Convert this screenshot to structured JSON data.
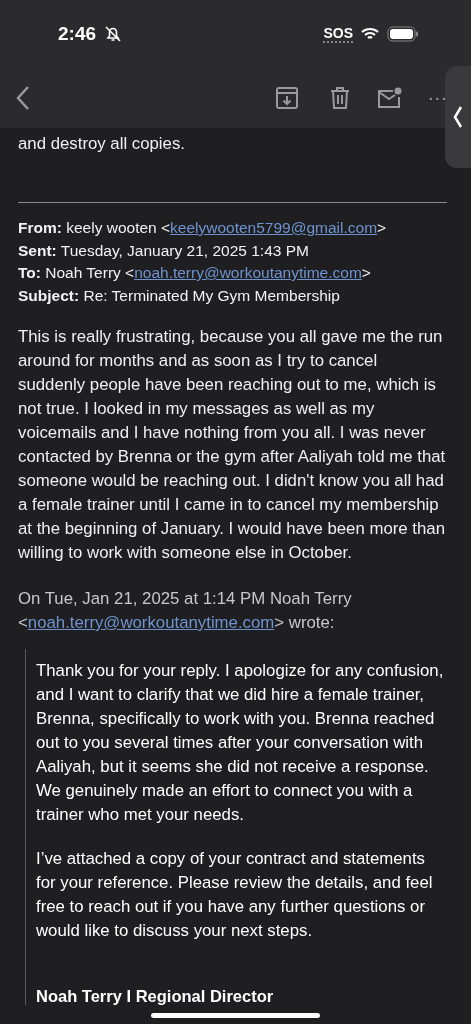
{
  "status_bar": {
    "time": "2:46",
    "sos": "SOS"
  },
  "toolbar": {
    "more": "..."
  },
  "body": {
    "trailing_text": "and destroy all copies.",
    "header_fields": [
      {
        "label": "From:",
        "text": "keely wooten <",
        "link": "keelywooten5799@gmail.com",
        "after": ">"
      },
      {
        "label": "Sent:",
        "text": "Tuesday, January 21, 2025 1:43 PM"
      },
      {
        "label": "To:",
        "text": "Noah Terry <",
        "link": "noah.terry@workoutanytime.com",
        "after": ">"
      },
      {
        "label": "Subject:",
        "text": "Re: Terminated My Gym Membership"
      }
    ],
    "paragraphs": [
      "This is really frustrating, because you all gave me the run around for months and as soon as I try to cancel suddenly people have been reaching out to me, which is not true. I looked in my messages as well as my voicemails and I have nothing from you all.  I was never contacted by Brenna or the gym after Aaliyah told me that someone would be reaching out. I didn't know you all had a female trainer until I came in to cancel my membership at the beginning of January. I would have been more than willing to work with someone else in October."
    ],
    "attribution": {
      "text": "On Tue, Jan 21, 2025 at 1:14 PM Noah Terry <",
      "link": "noah.terry@workoutanytime.com",
      "after": "> wrote:"
    },
    "quote": {
      "paragraphs": [
        "Thank you for your reply. I apologize for any confusion, and I want to clarify that we did hire a female trainer, Brenna, specifically to work with you. Brenna reached out to you several times after your conversation with Aaliyah, but it seems she did not receive a response. We genuinely made an effort to connect you with a trainer who met your needs.",
        "I’ve attached a copy of your contract and statements for your reference. Please review the details, and feel free to reach out if you have any further questions or would like to discuss your next steps."
      ],
      "signature": "Noah Terry I Regional Director"
    }
  }
}
